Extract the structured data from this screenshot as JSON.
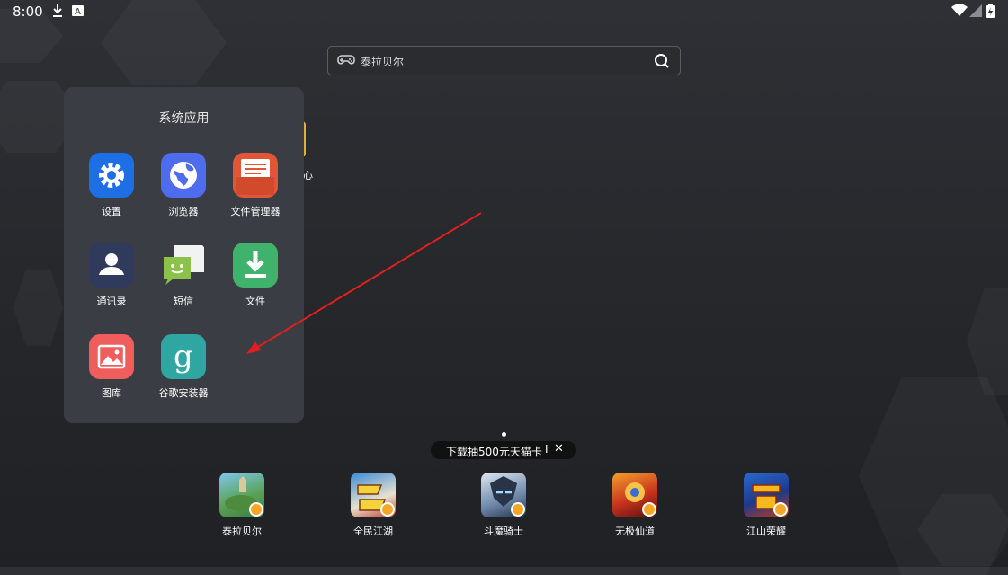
{
  "status_bar": {
    "time": "8:00",
    "icons": [
      "download-icon",
      "a-notification-icon",
      "wifi-icon",
      "signal-icon",
      "battery-icon"
    ]
  },
  "search": {
    "text": "泰拉贝尔",
    "left_icon": "gamepad-icon",
    "right_icon": "search-icon"
  },
  "folder": {
    "title": "系统应用",
    "apps": [
      {
        "label": "设置",
        "icon": "settings-icon",
        "color": "#1e6fe6"
      },
      {
        "label": "浏览器",
        "icon": "globe-icon",
        "color": "#4f6bee"
      },
      {
        "label": "文件管理器",
        "icon": "file-manager-icon",
        "color": "#e25536"
      },
      {
        "label": "通讯录",
        "icon": "contacts-icon",
        "color": "#2f3a5c"
      },
      {
        "label": "短信",
        "icon": "sms-icon",
        "color": "#8bc34a"
      },
      {
        "label": "文件",
        "icon": "file-download-icon",
        "color": "#3fb36c"
      },
      {
        "label": "图库",
        "icon": "gallery-icon",
        "color": "#ef5d5d"
      },
      {
        "label": "谷歌安装器",
        "icon": "google-installer-icon",
        "color": "#2fa6a2"
      }
    ]
  },
  "background_app_label_fragment": "心",
  "promo": {
    "text": "下载抽500元天猫卡",
    "separator": "I",
    "close": "✕"
  },
  "dock": [
    {
      "label": "泰拉贝尔",
      "icon": "terabell-icon"
    },
    {
      "label": "全民江湖",
      "icon": "quanmin-jianghu-icon"
    },
    {
      "label": "斗魔骑士",
      "icon": "doumo-knight-icon"
    },
    {
      "label": "无极仙道",
      "icon": "wuji-xiandao-icon"
    },
    {
      "label": "江山荣耀",
      "icon": "jiangshan-rongyao-icon"
    }
  ],
  "colors": {
    "arrow": "#e02020",
    "folder_bg": "#3a3d44",
    "badge": "#f5a623"
  }
}
